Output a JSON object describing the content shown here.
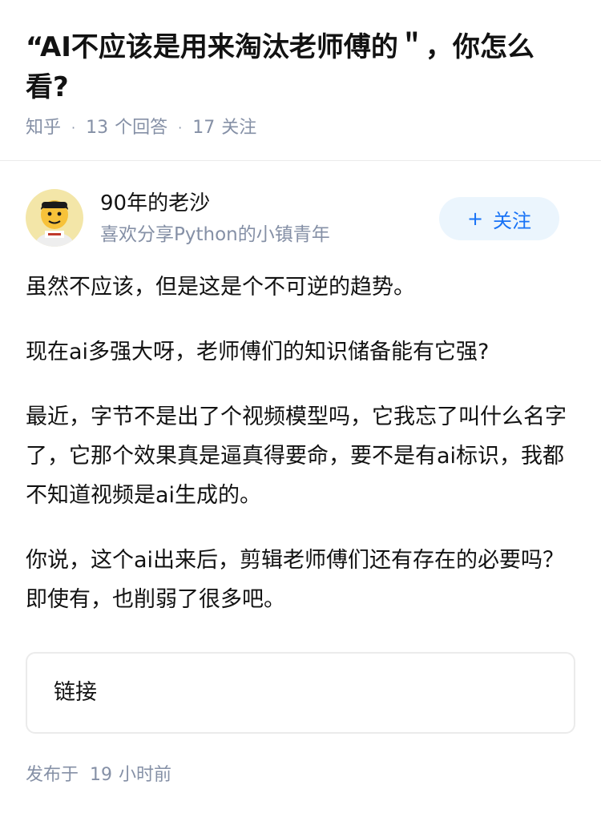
{
  "question": {
    "title": "“AI不应该是用来淘汰老师傅的＂，你怎么看?",
    "source": "知乎",
    "answer_count": "13",
    "answer_label": "个回答",
    "follow_count": "17",
    "follow_label": "关注"
  },
  "author": {
    "name": "90年的老沙",
    "bio": "喜欢分享Python的小镇青年",
    "follow_button_label": "关注"
  },
  "answer": {
    "paragraphs": [
      "虽然不应该，但是这是个不可逆的趋势。",
      "现在ai多强大呀，老师傅们的知识储备能有它强?",
      "最近，字节不是出了个视频模型吗，它我忘了叫什么名字了，它那个效果真是逼真得要命，要不是有ai标识，我都不知道视频是ai生成的。",
      "你说，这个ai出来后，剪辑老师傅们还有存在的必要吗？即使有，也削弱了很多吧。"
    ],
    "link_card_label": "链接",
    "published_prefix": "发布于",
    "published_value": "19",
    "published_suffix": "小时前"
  },
  "colors": {
    "text": "#121212",
    "muted": "#8590a6",
    "accent": "#1772f6",
    "accent_bg": "#ebf5fd"
  }
}
